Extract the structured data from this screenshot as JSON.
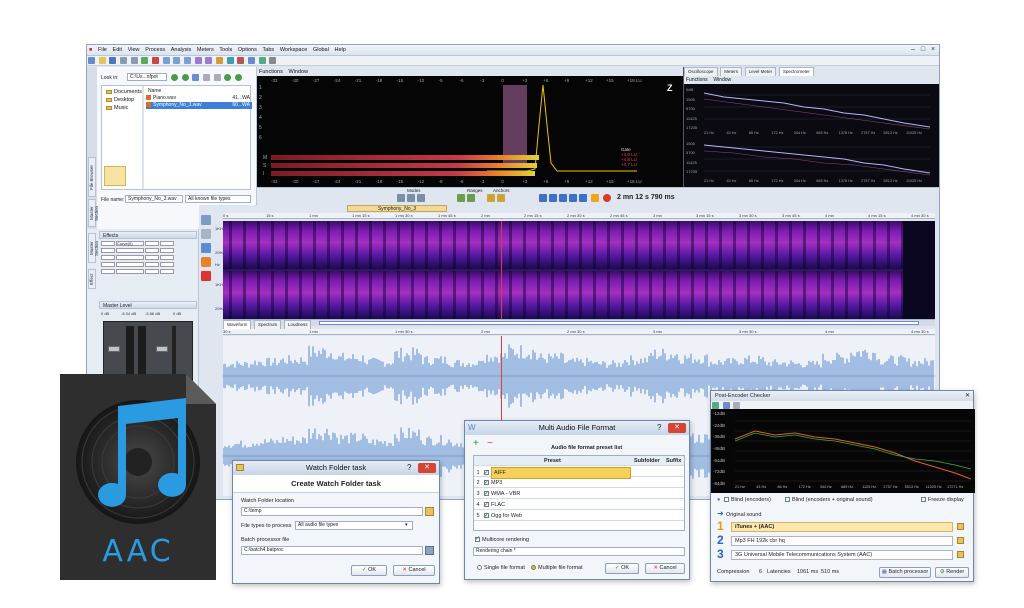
{
  "app": {
    "menu": [
      "File",
      "Edit",
      "View",
      "Process",
      "Analysis",
      "Meters",
      "Tools",
      "Options",
      "Tabs",
      "Workspace",
      "Global",
      "Help"
    ],
    "window_controls": [
      "–",
      "□",
      "×"
    ]
  },
  "browser": {
    "look_in_label": "Look in:",
    "look_in_value": "C:\\Us...nfpot",
    "tree": [
      "Documents",
      "Desktop",
      "Music"
    ],
    "column_name": "Name",
    "files": [
      {
        "name": "Piano.wav",
        "size": "41...WA"
      },
      {
        "name": "Symphony_No_3.wav",
        "size": "60...WA"
      }
    ],
    "filename_label": "File name:",
    "filename_value": "Symphony_No_3.wav",
    "filetype_value": "All known file types",
    "side_tabs": [
      "File Browser",
      "Master Section",
      "Effect"
    ]
  },
  "meters": {
    "menu": [
      "Functions",
      "Window"
    ],
    "scale": [
      "-33",
      "-30",
      "-27",
      "-24",
      "-21",
      "-18",
      "-15",
      "-12",
      "-9",
      "-6",
      "-3",
      "0",
      "+3",
      "+6",
      "+9",
      "+12",
      "+15",
      "+18 LU"
    ],
    "rows": [
      "1",
      "2",
      "3",
      "4",
      "5",
      "6"
    ],
    "channels": [
      "M",
      "S",
      "I"
    ],
    "gate_label": "Gate",
    "readouts": [
      "+4.9 LU",
      "+4.8 LU",
      "+4.7 LU"
    ]
  },
  "analyzer": {
    "tabs": [
      "Oscilloscope",
      "Meters",
      "Level Meter",
      "Spectrometer"
    ],
    "menu": [
      "Functions",
      "Window"
    ],
    "y_top": [
      "0dB",
      "1505",
      "5700",
      "11425",
      "17235"
    ],
    "y_bottom": [
      "1505",
      "5700",
      "11425",
      "17235"
    ],
    "x_freqs": [
      "21 Hz",
      "43 Hz",
      "86 Hz",
      "172 Hz",
      "344 Hz",
      "689 Hz",
      "1378 Hz",
      "2757 Hz",
      "5513 Hz",
      "11025 Hz"
    ]
  },
  "transport": {
    "modes_label": "Modes",
    "ranges_label": "Ranges",
    "anchors_label": "Anchors",
    "time": "2 mn 12 s 790 ms"
  },
  "mixer": {
    "effects_label": "Effects",
    "master_label": "Master Level",
    "slot_first": "Curve(0)",
    "meter_vals": [
      "0 dB",
      "-5.34 dB",
      "-5.86 dB",
      "0 dB"
    ]
  },
  "editor": {
    "file_tab": "Symphony_No_3",
    "ruler_top": [
      "0 s",
      "15 s",
      "1 mn",
      "1 mn 15 s",
      "1 mn 30 s",
      "1 mn 45 s",
      "2 mn",
      "2 mn 15 s",
      "2 mn 30 s",
      "2 mn 45 s",
      "3 mn",
      "3 mn 15 s",
      "3 mn 30 s",
      "3 mn 45 s",
      "4 mn",
      "4 mn 15 s",
      "4 mn 30 s"
    ],
    "view_tabs": [
      "Waveform",
      "Spectrum",
      "Loudness"
    ],
    "ruler_wave": [
      "30 s",
      "1 mn",
      "1 mn 30 s",
      "2 mn",
      "2 mn 30 s",
      "3 mn",
      "3 mn 30 s",
      "4 mn",
      "4 mn 30 s"
    ],
    "freq_labels": [
      "1KHz",
      "20Hz",
      "Hz",
      "1KHz",
      "20Hz"
    ]
  },
  "watch_folder": {
    "title": "Watch Folder task",
    "heading": "Create Watch Folder task",
    "location_label": "Watch Folder location",
    "location_value": "C:\\temp",
    "types_label": "File types to process",
    "types_value": "All audio file types",
    "batch_label": "Batch processor file",
    "batch_value": "C:\\batch4.batproc",
    "ok": "OK",
    "cancel": "Cancel"
  },
  "multi_format": {
    "title": "Multi Audio File Format",
    "preset_list_label": "Audio file format preset list",
    "col_preset": "Preset",
    "col_subfolder": "Subfolder",
    "col_suffix": "Suffix",
    "rows": [
      {
        "n": "1",
        "name": "AIFF",
        "checked": true
      },
      {
        "n": "2",
        "name": "MP3",
        "checked": true
      },
      {
        "n": "3",
        "name": "WMA - VBR",
        "checked": true
      },
      {
        "n": "4",
        "name": "FLAC",
        "checked": true
      },
      {
        "n": "5",
        "name": "Ogg for Web",
        "checked": true
      }
    ],
    "multicore": "Multicore rendering",
    "rendering_chain": "Rendering chain *",
    "single": "Single file format",
    "multiple": "Multiple file format",
    "ok": "OK",
    "cancel": "Cancel"
  },
  "encoder": {
    "title": "Post-Encoder Checker",
    "db_labels": [
      "-12dB",
      "-24dB",
      "-36dB",
      "-48dB",
      "-64dB",
      "-72dB",
      "-84dB"
    ],
    "freq_labels": [
      "21 Hz",
      "43 Hz",
      "86 Hz",
      "172 Hz",
      "344 Hz",
      "689 Hz",
      "1125 Hz",
      "2757 Hz",
      "5513 Hz",
      "11025 Hz",
      "17271 Hz"
    ],
    "blind": "Blind (encoders)",
    "blind_orig": "Blind (encoders + original sound)",
    "freeze": "Freeze display",
    "original": "Original sound",
    "items": [
      {
        "n": "1",
        "name": "iTunes + (AAC)"
      },
      {
        "n": "2",
        "name": "Mp3 FH 192k cbr hq"
      },
      {
        "n": "3",
        "name": "3G Universal Mobile Telecommunications System (AAC)"
      }
    ],
    "compression_label": "Compression",
    "compression_value": "6",
    "latencies_label": "Latencies",
    "latency_1": "1061 ms",
    "latency_2": "510 ms",
    "batch_btn": "Batch processor",
    "render_btn": "Render"
  },
  "aac_icon": {
    "label": "AAC"
  },
  "colors": {
    "accent": "#f3c200",
    "meter_red": "#c43a48",
    "spectro_purple": "#7a1cb0",
    "wave_blue": "#8fb0de",
    "aac_blue": "#2a9be0",
    "close_red": "#d54434"
  }
}
